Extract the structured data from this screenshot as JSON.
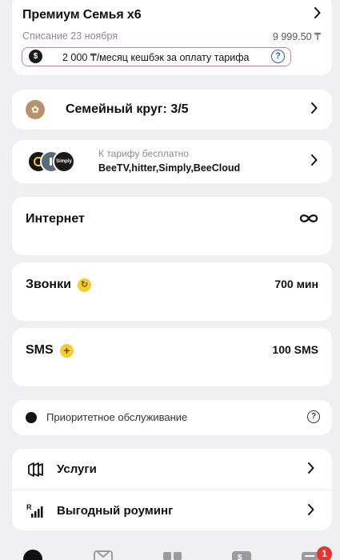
{
  "tariff": {
    "title": "Премиум Семья х6",
    "charge_label": "Списание 23 ноября",
    "charge_amount": "9 999.50 ₸",
    "cashback_text": "2 000 ₸/месяц кешбэк за оплату тарифа",
    "cashback_icon": "cashback-coin-icon",
    "accent_border": "#d47aa8",
    "help_color": "#2a5fb8"
  },
  "family": {
    "label": "Семейный круг: 3/5",
    "icon": "family-circle-icon",
    "icon_color": "#b8926a"
  },
  "free_services": {
    "label": "К тарифу бесплатно",
    "services": "BeeTV,hitter,Simply,BeeCloud",
    "logos": [
      "beetv-logo",
      "hitter-logo",
      "simply-logo"
    ],
    "simply_logo_text": "Simply"
  },
  "internet": {
    "title": "Интернет",
    "value_icon": "infinity-icon"
  },
  "calls": {
    "title": "Звонки",
    "value": "700 мин",
    "badge_icon": "refresh-badge-icon",
    "badge_color": "#f6cc2a"
  },
  "sms": {
    "title": "SMS",
    "value": "100 SMS",
    "badge_icon": "plus-badge-icon"
  },
  "priority": {
    "label": "Приоритетное обслуживание",
    "help_icon": "question-icon"
  },
  "services": {
    "items": [
      {
        "label": "Услуги",
        "icon": "services-icon"
      },
      {
        "label": "Выгодный роуминг",
        "icon": "roaming-icon"
      }
    ]
  },
  "bottom_nav": {
    "items": [
      "home-icon",
      "shop-icon",
      "apps-icon",
      "finance-icon",
      "notifications-icon"
    ],
    "badge": "1",
    "badge_color": "#e3342f"
  }
}
